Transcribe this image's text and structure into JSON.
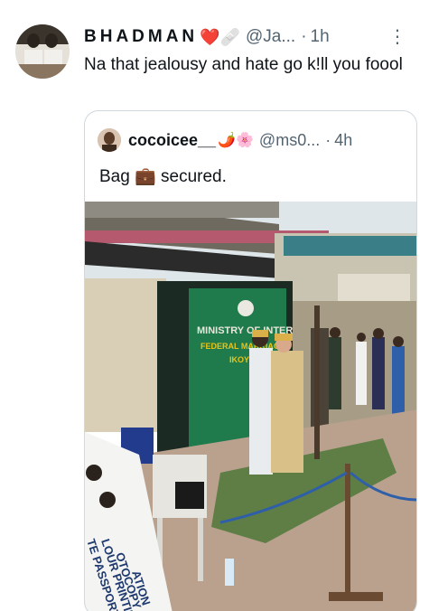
{
  "tweet": {
    "display_name": "BHADMAN",
    "name_emoji": "❤️🩹",
    "handle": "@Ja...",
    "dot": "·",
    "time": "1h",
    "more_icon": "more-dots-icon",
    "more_glyph": "⋮",
    "text": "Na that jealousy and hate go k!ll you foool"
  },
  "quote": {
    "display_name": "cocoicee__",
    "name_emoji": "🌶️🌸",
    "handle": "@ms0...",
    "dot": "·",
    "time": "4h",
    "text": "Bag 💼 secured.",
    "photo": {
      "sign_line1": "MINISTRY OF INTERIOR",
      "sign_line2": "FEDERAL MARRIAGE",
      "sign_line3": "IKOYI",
      "banner_line1": "TE PASSPORT",
      "banner_line2": "LOUR PRINTING",
      "banner_line3": "OTOCOPY",
      "banner_line4": "ATION"
    }
  },
  "colors": {
    "text": "#0f1419",
    "secondary": "#536471",
    "border": "#cfd9de",
    "sign_green": "#1f7a4c",
    "sign_yellow": "#e8c41a"
  }
}
